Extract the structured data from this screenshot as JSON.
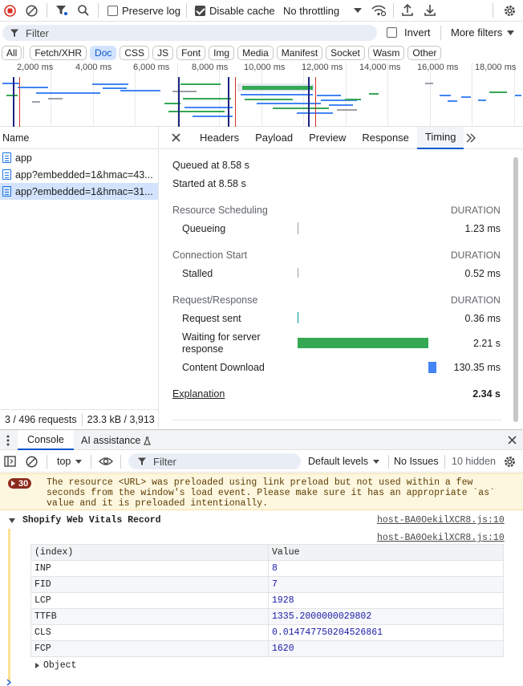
{
  "toolbar": {
    "preserve_log": "Preserve log",
    "disable_cache": "Disable cache",
    "throttling": "No throttling"
  },
  "filterbar": {
    "placeholder": "Filter",
    "invert": "Invert",
    "more_filters": "More filters"
  },
  "type_filters": [
    "All",
    "Fetch/XHR",
    "Doc",
    "CSS",
    "JS",
    "Font",
    "Img",
    "Media",
    "Manifest",
    "Socket",
    "Wasm",
    "Other"
  ],
  "overview": {
    "ticks": [
      "2,000 ms",
      "4,000 ms",
      "6,000 ms",
      "8,000 ms",
      "10,000 ms",
      "12,000 ms",
      "14,000 ms",
      "16,000 ms",
      "18,000 ms"
    ]
  },
  "requests": {
    "header": "Name",
    "items": [
      "app",
      "app?embedded=1&hmac=43...",
      "app?embedded=1&hmac=31..."
    ],
    "status": "3 / 496 requests",
    "transfer": "23.3 kB / 3,913"
  },
  "detail_tabs": [
    "Headers",
    "Payload",
    "Preview",
    "Response",
    "Timing"
  ],
  "timing": {
    "queued": "Queued at 8.58 s",
    "started": "Started at 8.58 s",
    "duration_label": "DURATION",
    "sections": [
      {
        "title": "Resource Scheduling",
        "rows": [
          {
            "label": "Queueing",
            "value": "1.23 ms"
          }
        ]
      },
      {
        "title": "Connection Start",
        "rows": [
          {
            "label": "Stalled",
            "value": "0.52 ms"
          }
        ]
      },
      {
        "title": "Request/Response",
        "rows": [
          {
            "label": "Request sent",
            "value": "0.36 ms"
          },
          {
            "label": "Waiting for server response",
            "value": "2.21 s"
          },
          {
            "label": "Content Download",
            "value": "130.35 ms"
          }
        ]
      }
    ],
    "explanation": "Explanation",
    "total": "2.34 s",
    "colors": {
      "waiting": "#34a853",
      "download": "#4285f4"
    }
  },
  "drawer": {
    "tabs": [
      "Console",
      "AI assistance"
    ]
  },
  "console": {
    "context": "top",
    "filter_placeholder": "Filter",
    "levels": "Default levels",
    "issues": "No Issues",
    "hidden": "10 hidden",
    "warning": {
      "count": "30",
      "text": "The resource <URL> was preloaded using link preload but not used within a few seconds from the window's load event. Please make sure it has an appropriate `as` value and it is preloaded intentionally."
    },
    "group_title": "Shopify Web Vitals Record",
    "source": "host-BA0OekilXCR8.js:10",
    "table": {
      "headers": [
        "(index)",
        "Value"
      ],
      "rows": [
        [
          "INP",
          "8"
        ],
        [
          "FID",
          "7"
        ],
        [
          "LCP",
          "1928"
        ],
        [
          "TTFB",
          "1335.2000000029802"
        ],
        [
          "CLS",
          "0.014747750204526861"
        ],
        [
          "FCP",
          "1620"
        ]
      ]
    },
    "object_label": "Object"
  }
}
